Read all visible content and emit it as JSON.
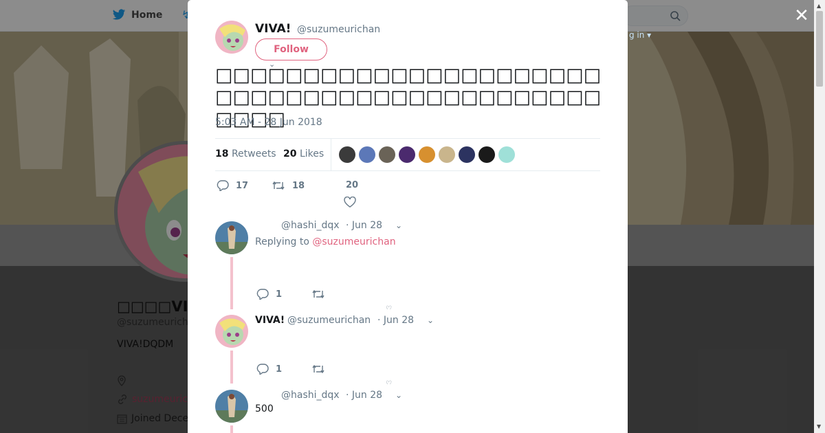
{
  "background": {
    "nav_home_label": "Home",
    "profile_name": "□□□□VIVA",
    "profile_handle": "@suzumeurich",
    "profile_bio": "VIVA!DQDM",
    "profile_link": "suzumeuric",
    "profile_joined": "Joined Dece",
    "login_hint": "g in ▾"
  },
  "modal": {
    "author": {
      "name": "VIVA!",
      "handle": "@suzumeurichan",
      "follow_label": "Follow"
    },
    "tweet_text": "□□□□□□□□□□□□□□□□□□□□□□□□□□□□□□□□□□□□□□□□□□□□□□□□",
    "timestamp": "5:03 AM - 28 Jun 2018",
    "stats": {
      "retweets_count": "18",
      "retweets_label": "Retweets",
      "likes_count": "20",
      "likes_label": "Likes"
    },
    "liker_colors": [
      "#3b3b3b",
      "#5c78b8",
      "#6a6357",
      "#4b2a6e",
      "#d7902f",
      "#c9b58c",
      "#2c3360",
      "#1a1a1a",
      "#9fe0d8"
    ],
    "actions": {
      "replies": "17",
      "retweets": "18",
      "likes": "20"
    },
    "replies": [
      {
        "name": "",
        "handle": "@hashi_dqx",
        "time": "· Jun 28",
        "replying_prefix": "Replying to",
        "replying_to": "@suzumeurichan",
        "text": "",
        "reply_count": "1"
      },
      {
        "name": "VIVA!",
        "handle": "@suzumeurichan",
        "time": "· Jun 28",
        "text": "",
        "reply_count": "1"
      },
      {
        "name": "",
        "handle": "@hashi_dqx",
        "time": "· Jun 28",
        "text": "500"
      }
    ]
  }
}
